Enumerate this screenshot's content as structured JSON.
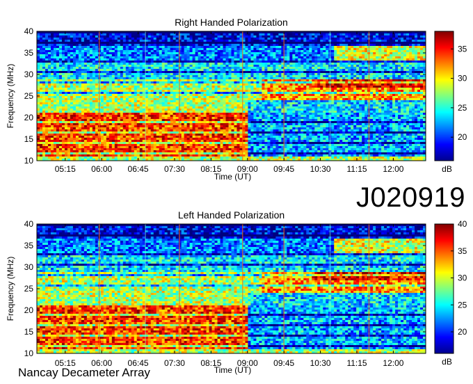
{
  "observation_label": "J020919",
  "footer_label": "Nancay Decameter Array",
  "chart_data": [
    {
      "type": "heatmap",
      "title": "Right Handed Polarization",
      "xlabel": "Time (UT)",
      "ylabel": "Frequency (MHz)",
      "x_ticks": [
        "05:15",
        "06:00",
        "06:45",
        "07:30",
        "08:15",
        "09:00",
        "09:45",
        "10:30",
        "11:15",
        "12:00"
      ],
      "y_ticks": [
        "10",
        "15",
        "20",
        "25",
        "30",
        "35",
        "40"
      ],
      "ylim": [
        10,
        40
      ],
      "colorbar": {
        "label": "dB",
        "ticks": [
          "20",
          "25",
          "30",
          "35"
        ],
        "range": [
          16,
          38
        ]
      },
      "colormap": "jet",
      "colors": {
        "low": "#00008f",
        "mid": "#7fff7f",
        "high": "#800000"
      }
    },
    {
      "type": "heatmap",
      "title": "Left Handed Polarization",
      "xlabel": "Time (UT)",
      "ylabel": "Frequency (MHz)",
      "x_ticks": [
        "05:15",
        "06:00",
        "06:45",
        "07:30",
        "08:15",
        "09:00",
        "09:45",
        "10:30",
        "11:15",
        "12:00"
      ],
      "y_ticks": [
        "10",
        "15",
        "20",
        "25",
        "30",
        "35",
        "40"
      ],
      "ylim": [
        10,
        40
      ],
      "colorbar": {
        "label": "dB",
        "ticks": [
          "20",
          "25",
          "30",
          "35",
          "40"
        ],
        "range": [
          16,
          40
        ]
      },
      "colormap": "jet",
      "colors": {
        "low": "#00008f",
        "mid": "#7fff7f",
        "high": "#800000"
      }
    }
  ]
}
